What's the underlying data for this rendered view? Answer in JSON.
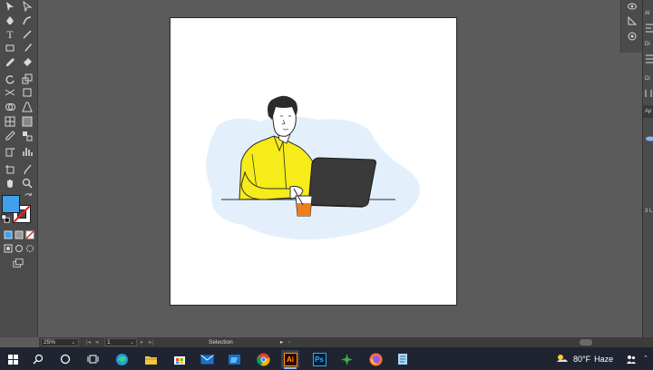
{
  "toolbar": {
    "tools": [
      "selection-tool",
      "direct-selection-tool",
      "pen-tool",
      "curvature-tool",
      "type-tool",
      "line-tool",
      "rectangle-tool",
      "paintbrush-tool",
      "pencil-tool",
      "eraser-tool",
      "rotate-tool",
      "scale-tool",
      "width-tool",
      "free-transform-tool",
      "shape-builder-tool",
      "perspective-grid-tool",
      "mesh-tool",
      "gradient-tool",
      "eyedropper-tool",
      "blend-tool",
      "symbol-sprayer-tool",
      "column-graph-tool",
      "artboard-tool",
      "slice-tool",
      "hand-tool",
      "zoom-tool"
    ],
    "fill_color": "#3fa1ee",
    "stroke_color": "#ffffff"
  },
  "statusbar": {
    "zoom": "25%",
    "artboard_number": "1",
    "tool_name": "Selection"
  },
  "right_panel": {
    "labels": [
      "Al",
      "Di",
      "Di",
      "Ap",
      "3 L"
    ]
  },
  "taskbar": {
    "apps": [
      "start",
      "search",
      "task-view",
      "widgets",
      "edge",
      "file-explorer",
      "microsoft-store",
      "mail",
      "movies-tv",
      "chrome",
      "illustrator",
      "photoshop",
      "anaconda",
      "firefox",
      "notepad"
    ],
    "illustrator_label": "Ai",
    "photoshop_label": "Ps",
    "weather_temp": "80°F",
    "weather_desc": "Haze"
  },
  "illustration": {
    "colors": {
      "blob": "#e3f0fb",
      "shirt": "#f5ec19",
      "hair": "#2b2b2b",
      "laptop": "#3a3a3a",
      "cup_liquid": "#f07e1f",
      "skin": "#ffffff"
    }
  }
}
